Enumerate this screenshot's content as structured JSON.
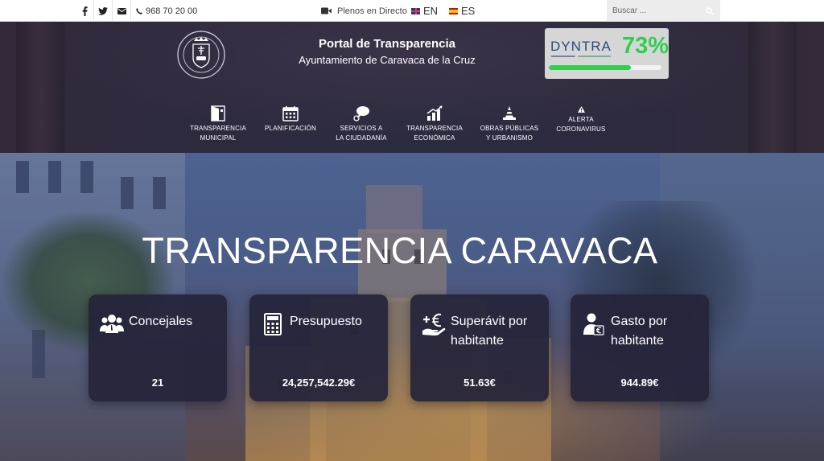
{
  "topbar": {
    "social": [
      {
        "name": "facebook-icon"
      },
      {
        "name": "twitter-icon"
      },
      {
        "name": "envelope-icon"
      }
    ],
    "phone": "968 70 20 00",
    "plenos_label": "Plenos en Directo",
    "lang_en": "EN",
    "lang_es": "ES",
    "search_placeholder": "Buscar ..."
  },
  "header": {
    "title": "Portal de Transparencia",
    "subtitle": "Ayuntamiento de Caravaca de la Cruz",
    "crest_text": "CARAVACA DE LA CRUZ",
    "dyntra": {
      "logo": "DYNTRA",
      "score_text": "73%",
      "score_fraction": 0.73
    }
  },
  "nav": [
    {
      "label": "TRANSPARENCIA\nMUNICIPAL",
      "icon": "door-icon"
    },
    {
      "label": "PLANIFICACIÓN",
      "icon": "calendar-icon"
    },
    {
      "label": "SERVICIOS A\nLA CIUDADANÍA",
      "icon": "chat-bubble-icon"
    },
    {
      "label": "TRANSPARENCIA\nECONÓMICA",
      "icon": "bar-chart-icon"
    },
    {
      "label": "OBRAS PÚBLICAS\nY URBANISMO",
      "icon": "traffic-cone-icon"
    },
    {
      "label": "ALERTA\nCORONAVIRUS",
      "icon": "warning-icon"
    }
  ],
  "hero": {
    "title": "TRANSPARENCIA CARAVACA"
  },
  "cards": [
    {
      "title": "Concejales",
      "value": "21",
      "icon": "users-icon"
    },
    {
      "title": "Presupuesto",
      "value": "24,257,542.29€",
      "icon": "calculator-icon"
    },
    {
      "title": "Superávit por habitante",
      "value": "51.63€",
      "icon": "euro-hand-icon"
    },
    {
      "title": "Gasto por habitante",
      "value": "944.89€",
      "icon": "person-euro-icon"
    }
  ],
  "colors": {
    "header_bg": "#2b2b40",
    "card_bg": "#25243a",
    "dyntra_green": "#2fcf4f",
    "dyntra_blue": "#2b4a7c"
  }
}
